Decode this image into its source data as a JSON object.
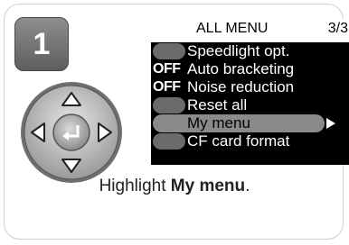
{
  "step": "1",
  "screen": {
    "title": "ALL MENU",
    "page": "3/3",
    "items": [
      {
        "icon": "",
        "label": "Speedlight opt."
      },
      {
        "icon": "OFF",
        "label": "Auto bracketing"
      },
      {
        "icon": "OFF",
        "label": "Noise reduction"
      },
      {
        "icon": "",
        "label": "Reset all"
      },
      {
        "icon": "",
        "label": "My menu",
        "selected": true
      },
      {
        "icon": "",
        "label": "CF card format"
      }
    ]
  },
  "caption": {
    "prefix": "Highlight ",
    "bold": "My menu",
    "suffix": "."
  }
}
